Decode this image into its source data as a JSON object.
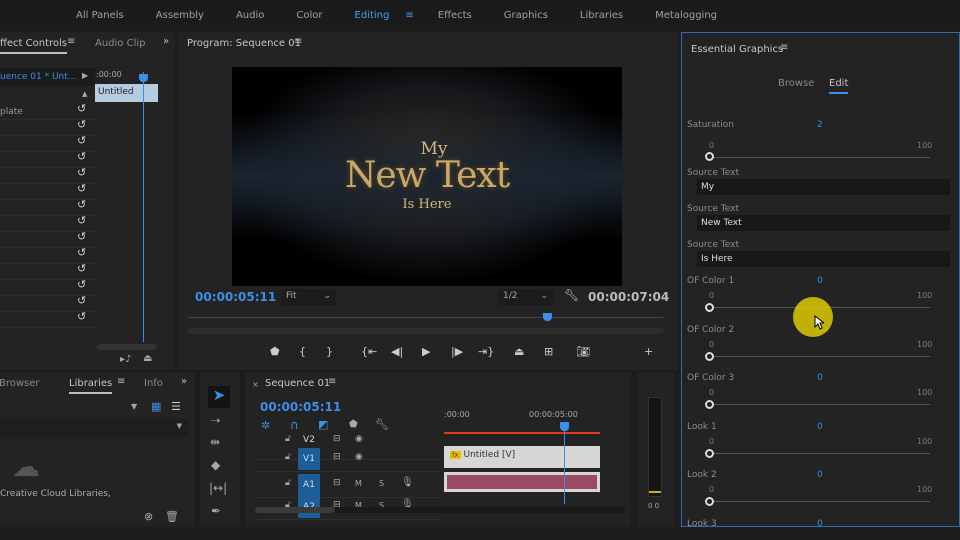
{
  "workspaces": {
    "items": [
      "All Panels",
      "Assembly",
      "Audio",
      "Color",
      "Editing",
      "Effects",
      "Graphics",
      "Libraries",
      "Metalogging"
    ],
    "active": "Editing"
  },
  "effect_controls": {
    "tab": "ffect Controls",
    "tab2": "Audio Clip",
    "source": "uence 01 * Unt...",
    "timecode": ":00:00",
    "clip": "Untitled",
    "row_label": "plate",
    "reset_rows": 14
  },
  "program": {
    "title": "Program: Sequence 01",
    "timecode": "00:00:05:11",
    "fit": "Fit",
    "resolution": "1/2",
    "duration": "00:00:07:04",
    "video_text": {
      "line1": "My",
      "line2": "New Text",
      "line3": "Is Here"
    },
    "playhead_fraction": 0.75
  },
  "essential_graphics": {
    "title": "Essential Graphics",
    "tabs": [
      "Browse",
      "Edit"
    ],
    "active_tab": "Edit",
    "saturation": {
      "label": "Saturation",
      "value": "2",
      "min": "0",
      "max": "100"
    },
    "source_texts": [
      {
        "label": "Source Text",
        "value": "My"
      },
      {
        "label": "Source Text",
        "value": "New Text"
      },
      {
        "label": "Source Text",
        "value": "Is Here"
      }
    ],
    "sliders": [
      {
        "label": "OF Color 1",
        "value": "0",
        "min": "0",
        "max": "100"
      },
      {
        "label": "OF Color 2",
        "value": "0",
        "min": "0",
        "max": "100"
      },
      {
        "label": "OF Color 3",
        "value": "0",
        "min": "0",
        "max": "100"
      },
      {
        "label": "Look 1",
        "value": "0",
        "min": "0",
        "max": "100"
      },
      {
        "label": "Look 2",
        "value": "0",
        "min": "0",
        "max": "100"
      },
      {
        "label": "Look 3",
        "value": "0"
      }
    ]
  },
  "libraries": {
    "tabs": [
      "Browser",
      "Libraries",
      "Info"
    ],
    "active": "Libraries",
    "message": "Creative Cloud Libraries,"
  },
  "timeline": {
    "title": "Sequence 01",
    "timecode": "00:00:05:11",
    "ruler": [
      ":00:00",
      "00:00:05:00"
    ],
    "tracks": [
      "V2",
      "V1",
      "A1",
      "A2"
    ],
    "clip": "Untitled [V]",
    "mute": "M",
    "solo": "S"
  },
  "meter": {
    "label": "0 0"
  },
  "colors": {
    "accent": "#3d8ee6",
    "cursor_highlight": "#e8d400"
  }
}
